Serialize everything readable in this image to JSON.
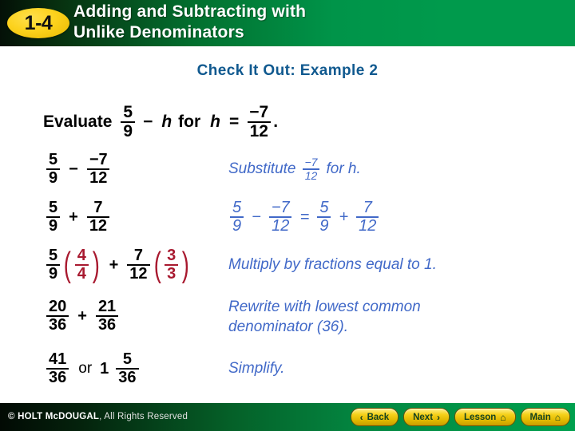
{
  "header": {
    "badge": "1-4",
    "title_line1": "Adding and Subtracting with",
    "title_line2": "Unlike Denominators",
    "accent_green": "#009a4c",
    "badge_color": "#fcd21d"
  },
  "slide": {
    "example_title": "Check It Out: Example 2",
    "title_color": "#10598f",
    "evaluate": {
      "word": "Evaluate",
      "expr_num": "5",
      "expr_den": "9",
      "minus": "−",
      "variable": "h",
      "for_word": "for",
      "variable2": "h",
      "equals": "=",
      "value_num": "−7",
      "value_den": "12",
      "period": "."
    },
    "steps": [
      {
        "left": {
          "frac1_num": "5",
          "frac1_den": "9",
          "operator": "−",
          "frac2_num": "−7",
          "frac2_den": "12"
        },
        "right_type": "substitute",
        "right_pre": "Substitute",
        "right_frac_num": "−7",
        "right_frac_den": "12",
        "right_post": "for h."
      },
      {
        "left": {
          "frac1_num": "5",
          "frac1_den": "9",
          "operator": "+",
          "frac2_num": "7",
          "frac2_den": "12"
        },
        "right_type": "equation",
        "eq_a_num": "5",
        "eq_a_den": "9",
        "eq_op1": "−",
        "eq_b_num": "−7",
        "eq_b_den": "12",
        "eq_equals": "=",
        "eq_c_num": "5",
        "eq_c_den": "9",
        "eq_op2": "+",
        "eq_d_num": "7",
        "eq_d_den": "12"
      },
      {
        "left": {
          "frac1_num": "5",
          "frac1_den": "9",
          "paren1_num": "4",
          "paren1_den": "4",
          "operator": "+",
          "frac2_num": "7",
          "frac2_den": "12",
          "paren2_num": "3",
          "paren2_den": "3",
          "paren_color": "#a8192f"
        },
        "right_type": "text",
        "right_text": "Multiply by fractions equal to 1."
      },
      {
        "left": {
          "frac1_num": "20",
          "frac1_den": "36",
          "operator": "+",
          "frac2_num": "21",
          "frac2_den": "36"
        },
        "right_type": "text2",
        "right_text_line1": "Rewrite with lowest common",
        "right_text_line2": "denominator (36)."
      },
      {
        "left": {
          "frac1_num": "41",
          "frac1_den": "36",
          "or_word": "or",
          "whole": "1",
          "frac2_num": "5",
          "frac2_den": "36"
        },
        "right_type": "text",
        "right_text": "Simplify."
      }
    ],
    "explanation_color": "#4169c8"
  },
  "footer": {
    "copyright_bold": "© HOLT McDOUGAL",
    "copyright_rest": ", All Rights Reserved",
    "buttons": [
      {
        "label": "Back",
        "icon": "chevron-left",
        "glyph": "‹"
      },
      {
        "label": "Next",
        "icon": "chevron-right",
        "glyph": "›"
      },
      {
        "label": "Lesson",
        "icon": "home",
        "glyph": "⌂"
      },
      {
        "label": "Main",
        "icon": "home",
        "glyph": "⌂"
      }
    ]
  }
}
